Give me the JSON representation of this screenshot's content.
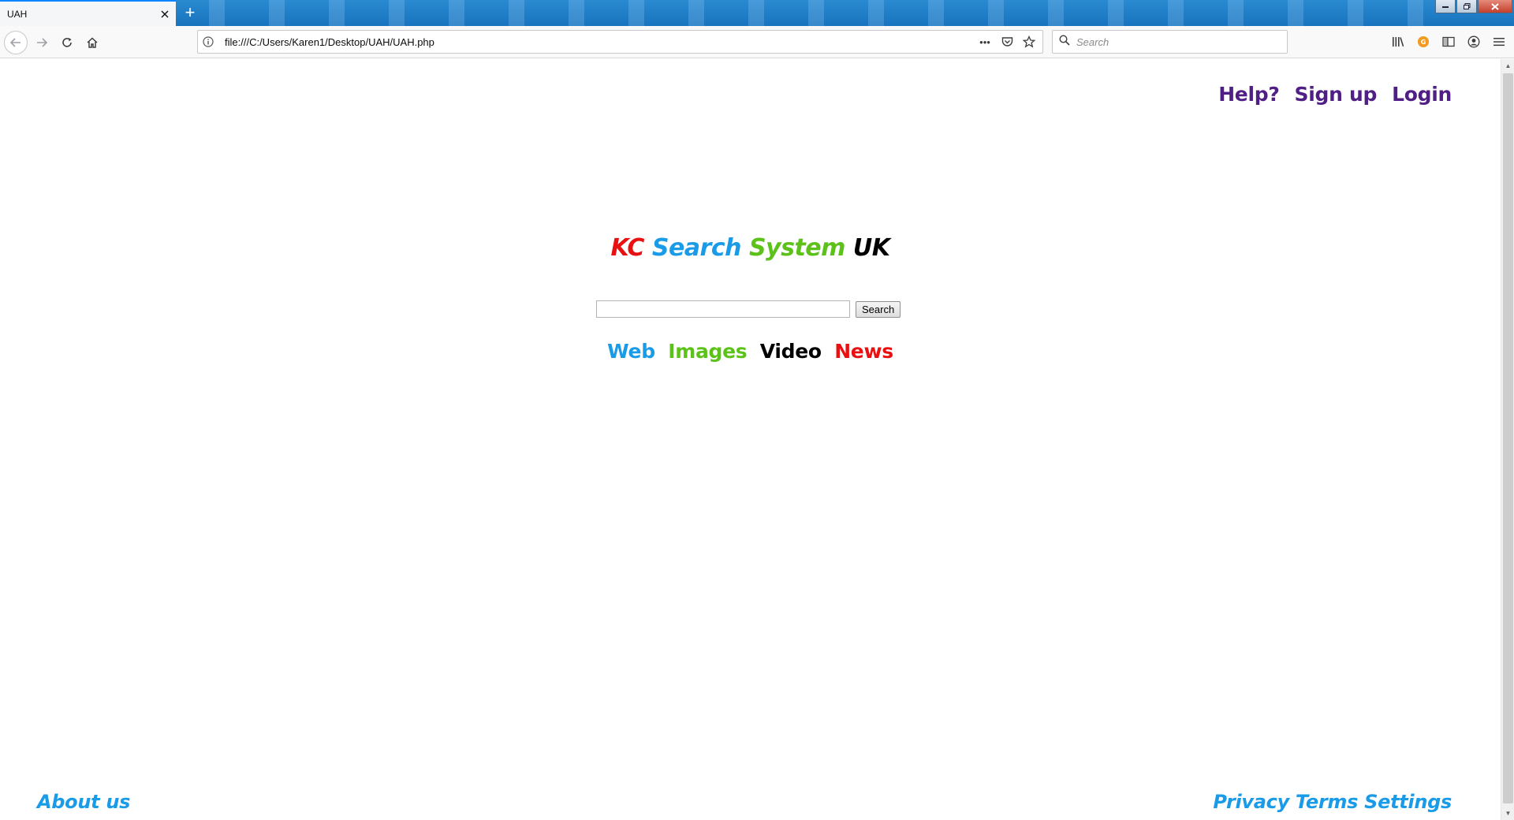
{
  "browser": {
    "tab_title": "UAH",
    "tab_close_icon": "close-icon",
    "new_tab_symbol": "+",
    "url": "file:///C:/Users/Karen1/Desktop/UAH/UAH.php",
    "search_placeholder": "Search",
    "page_actions_symbol": "•••",
    "accent_color": "#0a84ff"
  },
  "page": {
    "top_links": {
      "help": "Help?",
      "signup": "Sign up",
      "login": "Login"
    },
    "logo": {
      "word1": "KC",
      "word2": "Search",
      "word3": "System",
      "word4": "UK"
    },
    "search": {
      "input_value": "",
      "button_label": "Search"
    },
    "categories": {
      "web": "Web",
      "images": "Images",
      "video": "Video",
      "news": "News"
    },
    "footer": {
      "about": "About us",
      "privacy": "Privacy",
      "terms": "Terms",
      "settings": "Settings"
    },
    "colors": {
      "red": "#e81010",
      "blue": "#1a9be8",
      "green": "#5cc21a",
      "purple": "#4f1f86"
    }
  }
}
